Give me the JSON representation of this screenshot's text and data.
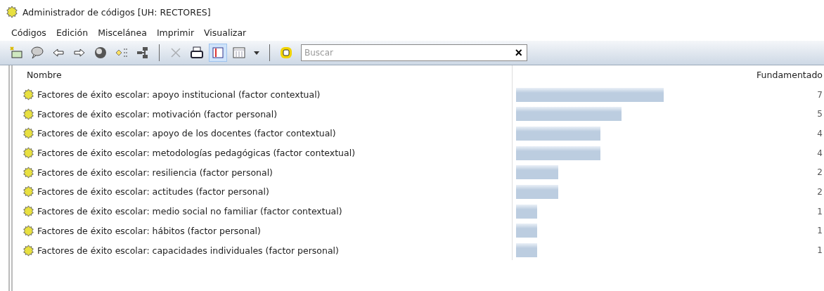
{
  "window": {
    "title": "Administrador de códigos [UH: RECTORES]"
  },
  "menu": [
    "Códigos",
    "Edición",
    "Miscelánea",
    "Imprimir",
    "Visualizar"
  ],
  "toolbar": [
    {
      "kind": "new-code",
      "disabled": false,
      "selected": false
    },
    {
      "kind": "comment",
      "disabled": false,
      "selected": false
    },
    {
      "kind": "back",
      "disabled": false,
      "selected": false
    },
    {
      "kind": "forward",
      "disabled": false,
      "selected": false
    },
    {
      "kind": "sphere",
      "disabled": false,
      "selected": false
    },
    {
      "kind": "filter",
      "disabled": false,
      "selected": false
    },
    {
      "kind": "network",
      "disabled": false,
      "selected": false
    },
    {
      "kind": "separator"
    },
    {
      "kind": "delete",
      "disabled": true,
      "selected": false
    },
    {
      "kind": "print",
      "disabled": false,
      "selected": false
    },
    {
      "kind": "panel",
      "disabled": false,
      "selected": true
    },
    {
      "kind": "table",
      "disabled": false,
      "selected": false
    },
    {
      "kind": "dropdown",
      "disabled": false,
      "selected": false
    },
    {
      "kind": "separator"
    },
    {
      "kind": "ring",
      "disabled": false,
      "selected": false
    }
  ],
  "search": {
    "placeholder": "Buscar",
    "clear": "×"
  },
  "table": {
    "columns": [
      "Nombre",
      "Fundamentado"
    ],
    "rows": [
      {
        "name": "Factores de éxito escolar: apoyo institucional (factor contextual)",
        "count": "7"
      },
      {
        "name": "Factores de éxito escolar: motivación (factor personal)",
        "count": "5"
      },
      {
        "name": "Factores de éxito escolar: apoyo de los docentes (factor contextual)",
        "count": "4"
      },
      {
        "name": "Factores de éxito escolar: metodologías pedagógicas (factor contextual)",
        "count": "4"
      },
      {
        "name": "Factores de éxito escolar: resiliencia (factor personal)",
        "count": "2"
      },
      {
        "name": "Factores de éxito escolar: actitudes (factor personal)",
        "count": "2"
      },
      {
        "name": "Factores de éxito escolar: medio social no familiar (factor contextual)",
        "count": "1"
      },
      {
        "name": "Factores de éxito escolar: hábitos (factor personal)",
        "count": "1"
      },
      {
        "name": "Factores de éxito escolar: capacidades individuales (factor personal)",
        "count": "1"
      }
    ]
  }
}
